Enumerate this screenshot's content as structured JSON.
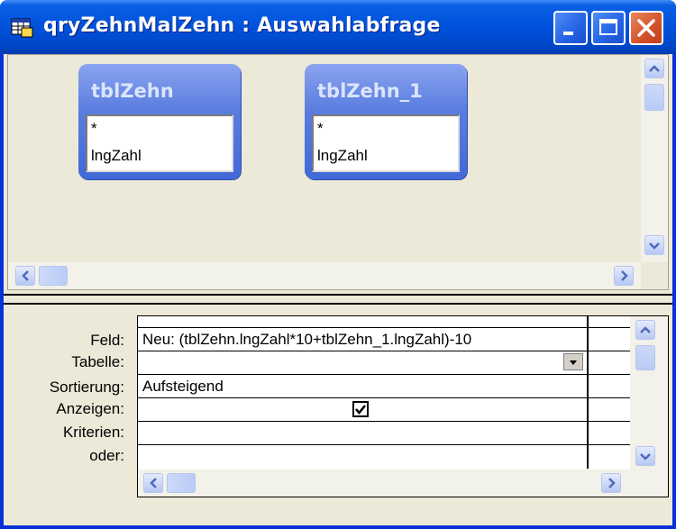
{
  "window": {
    "title": "qryZehnMalZehn : Auswahlabfrage",
    "app_icon": "query-icon",
    "buttons": {
      "minimize": "minimize-icon",
      "maximize": "maximize-icon",
      "close": "close-icon"
    }
  },
  "tables": [
    {
      "name": "tblZehn",
      "fields": [
        "*",
        "lngZahl"
      ]
    },
    {
      "name": "tblZehn_1",
      "fields": [
        "*",
        "lngZahl"
      ]
    }
  ],
  "grid": {
    "row_labels": {
      "feld": "Feld:",
      "tabelle": "Tabelle:",
      "sortierung": "Sortierung:",
      "anzeigen": "Anzeigen:",
      "kriterien": "Kriterien:",
      "oder": "oder:"
    },
    "column1": {
      "feld": "Neu: (tblZehn.lngZahl*10+tblZehn_1.lngZahl)-10",
      "tabelle": "",
      "sortierung": "Aufsteigend",
      "anzeigen": true,
      "kriterien": "",
      "oder": ""
    }
  },
  "colors": {
    "titlebar": "#0052dc",
    "frame": "#ece9d8",
    "table_header": "#5a7ddf",
    "close_button": "#d4502a"
  }
}
